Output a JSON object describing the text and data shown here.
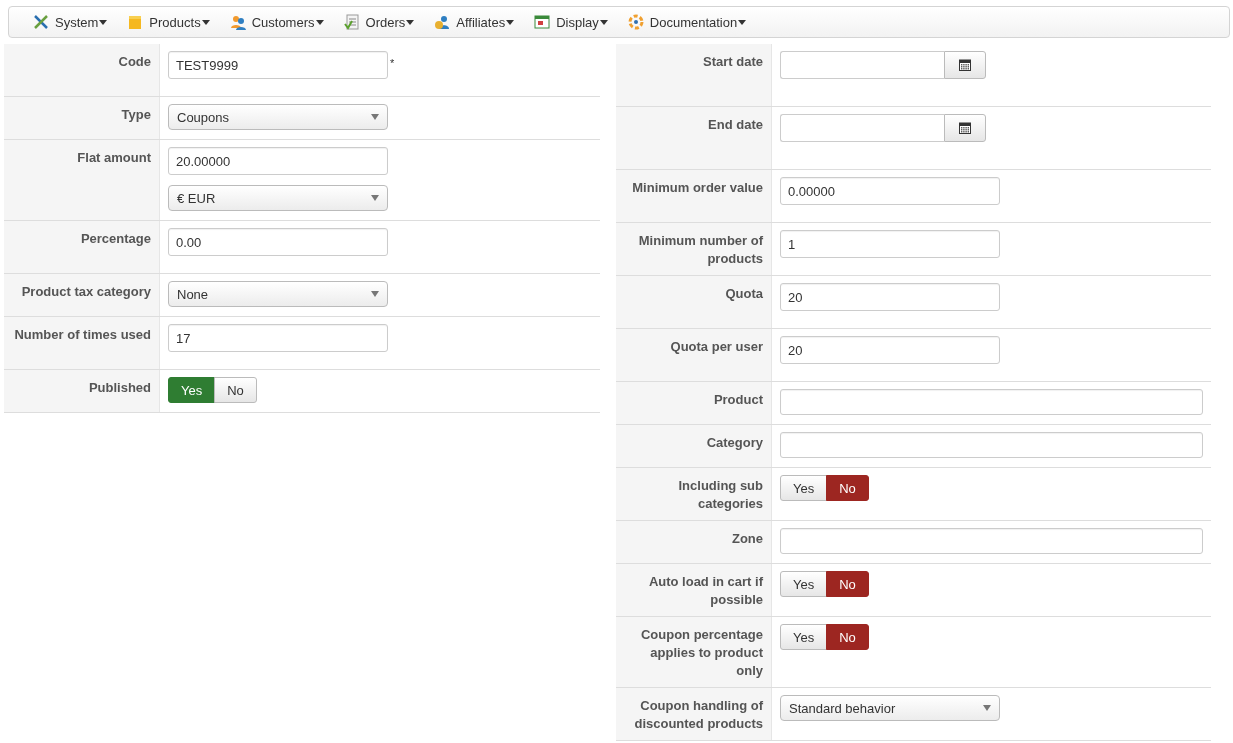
{
  "menu": [
    {
      "label": "System"
    },
    {
      "label": "Products"
    },
    {
      "label": "Customers"
    },
    {
      "label": "Orders"
    },
    {
      "label": "Affiliates"
    },
    {
      "label": "Display"
    },
    {
      "label": "Documentation"
    }
  ],
  "left_fields": [
    {
      "label": "Code",
      "controls": [
        {
          "kind": "text",
          "value": "TEST9999",
          "required_mark": "*"
        }
      ]
    },
    {
      "label": "Type",
      "controls": [
        {
          "kind": "select",
          "value": "Coupons"
        }
      ]
    },
    {
      "label": "Flat amount",
      "controls": [
        {
          "kind": "text",
          "value": "20.00000"
        },
        {
          "kind": "select",
          "value": "€ EUR"
        }
      ]
    },
    {
      "label": "Percentage",
      "controls": [
        {
          "kind": "text",
          "value": "0.00"
        }
      ]
    },
    {
      "label": "Product tax category",
      "controls": [
        {
          "kind": "select",
          "value": "None"
        }
      ]
    },
    {
      "label": "Number of times used",
      "controls": [
        {
          "kind": "text",
          "value": "17"
        }
      ]
    },
    {
      "label": "Published",
      "controls": [
        {
          "kind": "toggle",
          "options": [
            {
              "label": "Yes",
              "selected": true
            },
            {
              "label": "No",
              "selected": false
            }
          ]
        }
      ]
    }
  ],
  "right_fields": [
    {
      "label": "Start date",
      "controls": [
        {
          "kind": "date"
        }
      ]
    },
    {
      "label": "End date",
      "controls": [
        {
          "kind": "date"
        }
      ]
    },
    {
      "label": "Minimum order value",
      "controls": [
        {
          "kind": "text",
          "value": "0.00000"
        }
      ]
    },
    {
      "label": "Minimum number of products",
      "controls": [
        {
          "kind": "text",
          "value": "1"
        }
      ]
    },
    {
      "label": "Quota",
      "controls": [
        {
          "kind": "text",
          "value": "20"
        }
      ]
    },
    {
      "label": "Quota per user",
      "controls": [
        {
          "kind": "text",
          "value": "20"
        }
      ]
    },
    {
      "label": "Product",
      "controls": [
        {
          "kind": "wide"
        }
      ]
    },
    {
      "label": "Category",
      "controls": [
        {
          "kind": "wide"
        }
      ]
    },
    {
      "label": "Including sub categories",
      "controls": [
        {
          "kind": "toggle",
          "options": [
            {
              "label": "Yes",
              "selected": false
            },
            {
              "label": "No",
              "selected": true
            }
          ]
        }
      ]
    },
    {
      "label": "Zone",
      "controls": [
        {
          "kind": "wide"
        }
      ]
    },
    {
      "label": "Auto load in cart if possible",
      "controls": [
        {
          "kind": "toggle",
          "options": [
            {
              "label": "Yes",
              "selected": false
            },
            {
              "label": "No",
              "selected": true
            }
          ]
        }
      ]
    },
    {
      "label": "Coupon percentage applies to product only",
      "controls": [
        {
          "kind": "toggle",
          "options": [
            {
              "label": "Yes",
              "selected": false
            },
            {
              "label": "No",
              "selected": true
            }
          ]
        }
      ]
    },
    {
      "label": "Coupon handling of discounted products",
      "controls": [
        {
          "kind": "select",
          "value": "Standard behavior"
        }
      ]
    }
  ]
}
